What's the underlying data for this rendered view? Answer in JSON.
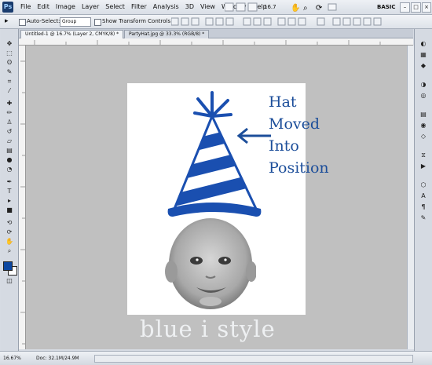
{
  "app": {
    "logo_text": "Ps"
  },
  "menu": {
    "items": [
      "File",
      "Edit",
      "Image",
      "Layer",
      "Select",
      "Filter",
      "Analysis",
      "3D",
      "View",
      "Window",
      "Help"
    ]
  },
  "appbar": {
    "zoom": "16.7",
    "workspace": "BASIC"
  },
  "options": {
    "auto_select_label": "Auto-Select:",
    "auto_select_value": "Group",
    "transform_label": "Show Transform Controls"
  },
  "tabs": [
    {
      "label": "Untitled-1 @ 16.7% (Layer 2, CMYK/8) *"
    },
    {
      "label": "PartyHat.jpg @ 33.3% (RGB/8) *"
    }
  ],
  "annotation": {
    "line1": "Hat",
    "line2": "Moved",
    "line3": "Into",
    "line4": "Position"
  },
  "watermark": "blue i style",
  "status": {
    "zoom": "16.67%",
    "doc": "Doc: 32.1M/24.9M"
  },
  "colors": {
    "foreground": "#0c47a1",
    "background": "#ffffff",
    "hat_blue": "#1a4fb0",
    "annotation": "#1c4e9a"
  },
  "icons": {
    "toolbox": [
      "move-icon",
      "marquee-icon",
      "lasso-icon",
      "quick-select-icon",
      "crop-icon",
      "eyedropper-icon",
      "healing-icon",
      "brush-icon",
      "clone-stamp-icon",
      "history-brush-icon",
      "eraser-icon",
      "gradient-icon",
      "blur-icon",
      "dodge-icon",
      "pen-icon",
      "type-icon",
      "path-select-icon",
      "shape-icon",
      "3d-rotate-icon",
      "3d-orbit-icon",
      "hand-icon",
      "zoom-icon"
    ],
    "panels": [
      "color-panel-icon",
      "swatches-panel-icon",
      "styles-panel-icon",
      "adjustments-panel-icon",
      "masks-panel-icon",
      "layers-panel-icon",
      "channels-panel-icon",
      "paths-panel-icon",
      "history-panel-icon",
      "actions-panel-icon",
      "3d-panel-icon",
      "character-panel-icon"
    ]
  }
}
